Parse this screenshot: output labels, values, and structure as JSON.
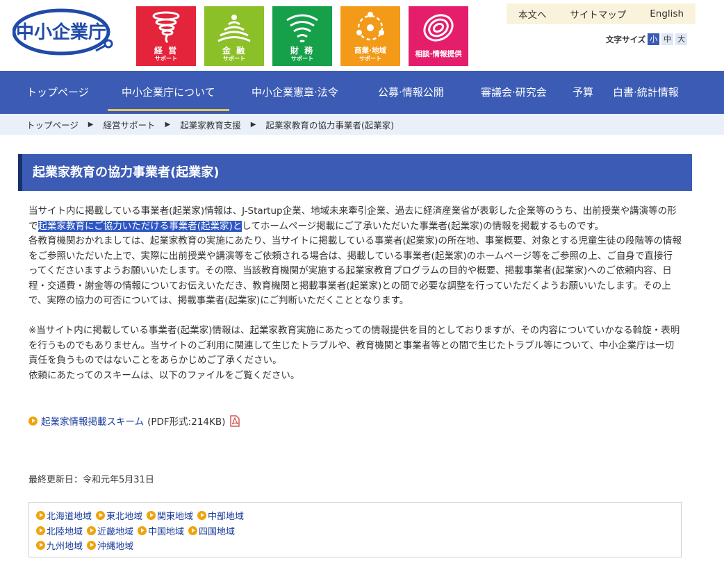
{
  "header": {
    "logo_text": "中小企業庁",
    "tiles": [
      {
        "label": "経 営",
        "sub": "サポート",
        "color": "#e3243b",
        "icon": "tornado-icon"
      },
      {
        "label": "金 融",
        "sub": "サポート",
        "color": "#8cc028",
        "icon": "wave-icon"
      },
      {
        "label": "財 務",
        "sub": "サポート",
        "color": "#16a04a",
        "icon": "wifi-icon"
      },
      {
        "label": "商業·地域",
        "sub": "サポート",
        "color": "#f39a18",
        "icon": "orbit-icon"
      },
      {
        "label": "相談·情報提供",
        "sub": "",
        "color": "#e51e6c",
        "icon": "spiral-icon"
      }
    ],
    "util_links": [
      "本文へ",
      "サイトマップ",
      "English"
    ],
    "font_size_label": "文字サイズ",
    "font_sizes": [
      "小",
      "中",
      "大"
    ]
  },
  "nav": {
    "items": [
      "トップページ",
      "中小企業庁について",
      "中小企業憲章·法令",
      "公募·情報公開",
      "審議会·研究会",
      "予算",
      "白書·統計情報"
    ]
  },
  "breadcrumb": [
    "トップページ",
    "経営サポート",
    "起業家教育支援",
    "起業家教育の協力事業者(起業家)"
  ],
  "main": {
    "title": "起業家教育の協力事業者(起業家)",
    "p1_before": "当サイト内に掲載している事業者(起業家)情報は、J-Startup企業、地域未来牽引企業、過去に経済産業省が表彰した企業等のうち、出前授業や講演等の形で",
    "p1_highlight": "起業家教育にご協力いただける事業者(起業家)と",
    "p1_after": "してホームページ掲載にご了承いただいた事業者(起業家)の情報を掲載するものです。",
    "p2": "各教育機関おかれましては、起業家教育の実施にあたり、当サイトに掲載している事業者(起業家)の所在地、事業概要、対象とする児童生徒の段階等の情報をご参照いただいた上で、実際に出前授業や講演等をご依頼される場合は、掲載している事業者(起業家)のホームページ等をご参照の上、ご自身で直接行ってくださいますようお願いいたします。その際、当該教育機関が実施する起業家教育プログラムの目的や概要、掲載事業者(起業家)へのご依頼内容、日程・交通費・謝金等の情報についてお伝えいただき、教育機関と掲載事業者(起業家)との間で必要な調整を行っていただくようお願いいたします。その上で、実際の協力の可否については、掲載事業者(起業家)にご判断いただくこととなります。",
    "p3": "※当サイト内に掲載している事業者(起業家)情報は、起業家教育実施にあたっての情報提供を目的としておりますが、その内容についていかなる斡旋・表明を行うものでもありません。当サイトのご利用に関連して生じたトラブルや、教育機関と事業者等との間で生じたトラブル等について、中小企業庁は一切責任を負うものではないことをあらかじめご了承ください。",
    "p4": "依頼にあたってのスキームは、以下のファイルをご覧ください。",
    "file_link": "起業家情報掲載スキーム",
    "file_meta": "(PDF形式:214KB)",
    "updated": "最終更新日：令和元年5月31日"
  },
  "regions": [
    [
      "北海道地域",
      "東北地域",
      "関東地域",
      "中部地域"
    ],
    [
      "北陸地域",
      "近畿地域",
      "中国地域",
      "四国地域"
    ],
    [
      "九州地域",
      "沖縄地域"
    ]
  ],
  "colors": {
    "nav": "#3b5bb4",
    "accent": "#e8c550",
    "link": "#1a3c9c"
  }
}
